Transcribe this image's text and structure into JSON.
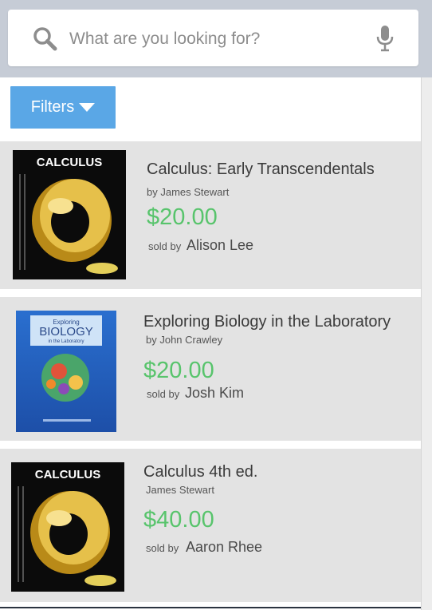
{
  "search": {
    "placeholder": "What are you looking for?",
    "icon": "search-icon",
    "voice_icon": "microphone-icon"
  },
  "filters": {
    "label": "Filters",
    "icon": "caret-down-icon"
  },
  "colors": {
    "accent": "#5aa7e6",
    "price": "#58c46c",
    "card_bg": "#e3e3e3"
  },
  "listings": [
    {
      "title": "Calculus: Early Transcendentals",
      "author": "by James Stewart",
      "price": "$20.00",
      "sold_by_label": "sold by",
      "seller": "Alison Lee",
      "cover": {
        "title_text": "CALCULUS"
      }
    },
    {
      "title": "Exploring Biology in the Laboratory",
      "author": "by John Crawley",
      "price": "$20.00",
      "sold_by_label": "sold by",
      "seller": "Josh Kim",
      "cover": {
        "title_text_1": "Exploring",
        "title_text_2": "BIOLOGY",
        "title_text_3": "in the Laboratory"
      }
    },
    {
      "title": "Calculus 4th ed.",
      "author": "James Stewart",
      "price": "$40.00",
      "sold_by_label": "sold by",
      "seller": "Aaron Rhee",
      "cover": {
        "title_text": "CALCULUS"
      }
    }
  ]
}
